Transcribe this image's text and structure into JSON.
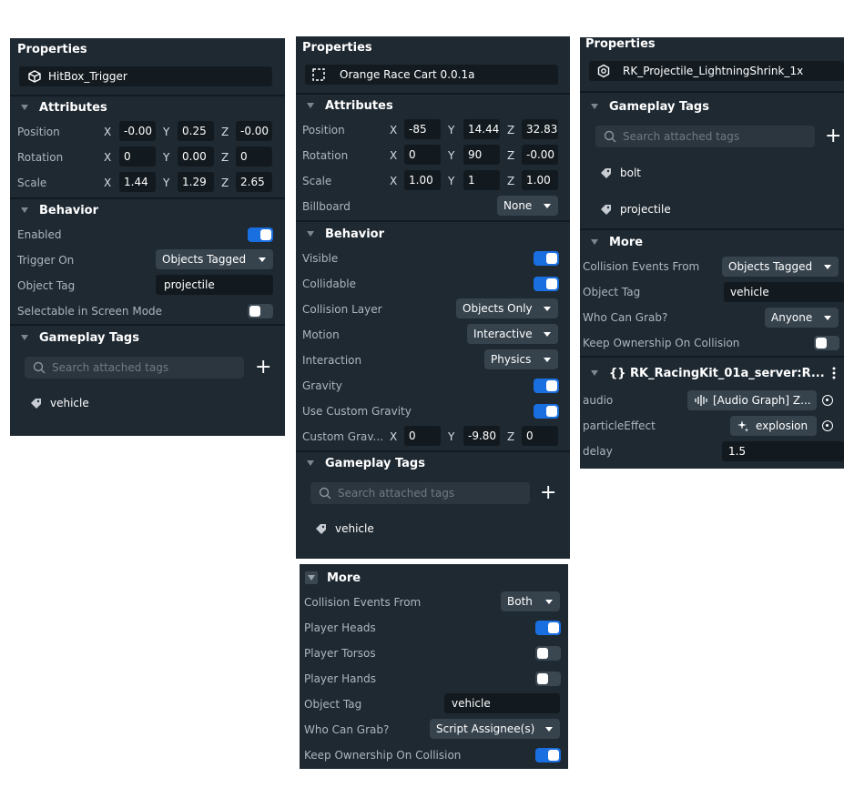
{
  "panel1": {
    "title": "Properties",
    "name": "HitBox_Trigger",
    "attributes_label": "Attributes",
    "rows": [
      {
        "label": "Position",
        "x": "-0.00",
        "y": "0.25",
        "z": "-0.00"
      },
      {
        "label": "Rotation",
        "x": "0",
        "y": "0.00",
        "z": "0"
      },
      {
        "label": "Scale",
        "x": "1.44",
        "y": "1.29",
        "z": "2.65"
      }
    ],
    "behavior_label": "Behavior",
    "enabled_label": "Enabled",
    "enabled": true,
    "trigger_on_label": "Trigger On",
    "trigger_on_value": "Objects Tagged",
    "object_tag_label": "Object Tag",
    "object_tag_value": "projectile",
    "selectable_label": "Selectable in Screen Mode",
    "selectable": false,
    "gameplay_tags_label": "Gameplay Tags",
    "search_placeholder": "Search attached tags",
    "tags": [
      "vehicle"
    ]
  },
  "panel2": {
    "title": "Properties",
    "name": "Orange Race Cart 0.0.1a",
    "attributes_label": "Attributes",
    "rows": [
      {
        "label": "Position",
        "x": "-85",
        "y": "14.44",
        "z": "32.83"
      },
      {
        "label": "Rotation",
        "x": "0",
        "y": "90",
        "z": "-0.00"
      },
      {
        "label": "Scale",
        "x": "1.00",
        "y": "1",
        "z": "1.00"
      }
    ],
    "billboard_label": "Billboard",
    "billboard_value": "None",
    "behavior_label": "Behavior",
    "visible_label": "Visible",
    "collidable_label": "Collidable",
    "collision_layer_label": "Collision Layer",
    "collision_layer_value": "Objects Only",
    "motion_label": "Motion",
    "motion_value": "Interactive",
    "interaction_label": "Interaction",
    "interaction_value": "Physics",
    "gravity_label": "Gravity",
    "custom_gravity_label": "Use Custom Gravity",
    "custom_grav_label": "Custom Grav...",
    "custom_grav": {
      "x": "0",
      "y": "-9.80",
      "z": "0"
    },
    "gameplay_tags_label": "Gameplay Tags",
    "search_placeholder": "Search attached tags",
    "tags": [
      "vehicle"
    ]
  },
  "panel3": {
    "more_label": "More",
    "collision_events_label": "Collision Events From",
    "collision_events_value": "Both",
    "player_heads_label": "Player Heads",
    "player_heads": true,
    "player_torsos_label": "Player Torsos",
    "player_torsos": false,
    "player_hands_label": "Player Hands",
    "player_hands": false,
    "object_tag_label": "Object Tag",
    "object_tag_value": "vehicle",
    "who_can_grab_label": "Who Can Grab?",
    "who_can_grab_value": "Script Assignee(s)",
    "keep_ownership_label": "Keep Ownership On Collision",
    "keep_ownership": true
  },
  "panel4": {
    "title": "Properties",
    "name": "RK_Projectile_LightningShrink_1x",
    "gameplay_tags_label": "Gameplay Tags",
    "search_placeholder": "Search attached tags",
    "tags": [
      "bolt",
      "projectile"
    ],
    "more_label": "More",
    "collision_events_label": "Collision Events From",
    "collision_events_value": "Objects Tagged",
    "object_tag_label": "Object Tag",
    "object_tag_value": "vehicle",
    "who_can_grab_label": "Who Can Grab?",
    "who_can_grab_value": "Anyone",
    "keep_ownership_label": "Keep Ownership On Collision",
    "keep_ownership": false,
    "script_label": "{} RK_RacingKit_01a_server:R...",
    "audio_label": "audio",
    "audio_value": "[Audio Graph] Z...",
    "particle_label": "particleEffect",
    "particle_value": "explosion",
    "delay_label": "delay",
    "delay_value": "1.5"
  },
  "colors": {
    "panel_bg": "#1e2932",
    "field_bg": "#121a1f",
    "dropdown_bg": "#36434d",
    "toggle_on": "#1a6fe0",
    "toggle_off": "#3a4650"
  }
}
